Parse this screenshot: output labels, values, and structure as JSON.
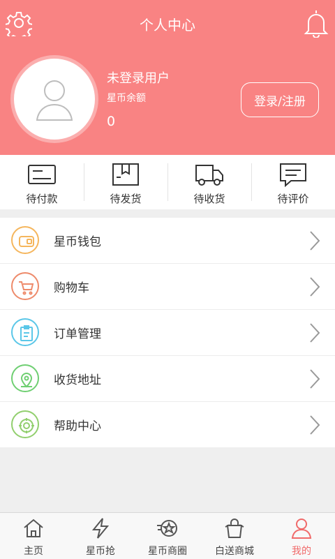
{
  "header": {
    "title": "个人中心",
    "username": "未登录用户",
    "balance_label": "星币余额",
    "balance_value": "0",
    "login_label": "登录/注册",
    "bg_color": "#f98383"
  },
  "orders": [
    {
      "label": "待付款",
      "icon": "card-icon"
    },
    {
      "label": "待发货",
      "icon": "box-icon"
    },
    {
      "label": "待收货",
      "icon": "truck-icon"
    },
    {
      "label": "待评价",
      "icon": "comment-icon"
    }
  ],
  "menu": [
    {
      "label": "星币钱包",
      "icon": "wallet-icon",
      "color": "#f5b65d"
    },
    {
      "label": "购物车",
      "icon": "cart-icon",
      "color": "#ee8a6a"
    },
    {
      "label": "订单管理",
      "icon": "clipboard-icon",
      "color": "#5bc7e8"
    },
    {
      "label": "收货地址",
      "icon": "location-icon",
      "color": "#6fcf72"
    },
    {
      "label": "帮助中心",
      "icon": "help-icon",
      "color": "#92cf6e"
    }
  ],
  "tabs": [
    {
      "label": "主页",
      "icon": "home-icon"
    },
    {
      "label": "星币抢",
      "icon": "lightning-icon"
    },
    {
      "label": "星币商圈",
      "icon": "star-circle-icon"
    },
    {
      "label": "白送商城",
      "icon": "gift-bag-icon"
    },
    {
      "label": "我的",
      "icon": "user-icon",
      "active": true
    }
  ]
}
